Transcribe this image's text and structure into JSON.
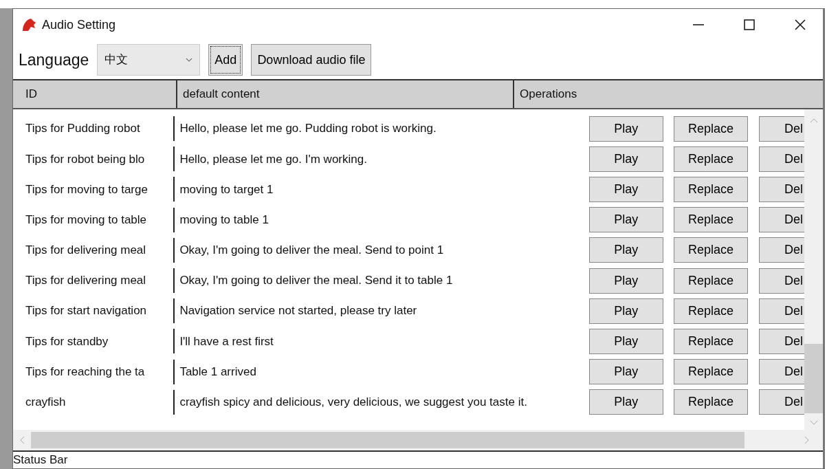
{
  "window": {
    "title": "Audio Setting"
  },
  "toolbar": {
    "language_label": "Language",
    "language_select": {
      "value": "中文"
    },
    "buttons": [
      {
        "label": "Add",
        "focused": true
      },
      {
        "label": "Download audio file",
        "focused": false
      }
    ]
  },
  "table": {
    "columns": [
      "ID",
      "default content",
      "Operations"
    ],
    "rows": [
      {
        "id": "Tips for Pudding robot",
        "content": "Hello, please let me go. Pudding robot is working.",
        "actions": [
          "Play",
          "Replace",
          "Del"
        ]
      },
      {
        "id": "Tips for robot being blo",
        "content": "Hello, please let me go. I'm working.",
        "actions": [
          "Play",
          "Replace",
          "Del"
        ]
      },
      {
        "id": "Tips for moving to targe",
        "content": "moving to target 1",
        "actions": [
          "Play",
          "Replace",
          "Del"
        ]
      },
      {
        "id": "Tips for moving to table",
        "content": "moving to table 1",
        "actions": [
          "Play",
          "Replace",
          "Del"
        ]
      },
      {
        "id": "Tips for delivering meal",
        "content": "Okay, I'm going to deliver the meal. Send to point 1",
        "actions": [
          "Play",
          "Replace",
          "Del"
        ]
      },
      {
        "id": "Tips for delivering meal",
        "content": "Okay, I'm going to deliver the meal. Send it to table 1",
        "actions": [
          "Play",
          "Replace",
          "Del"
        ]
      },
      {
        "id": "Tips for start navigation",
        "content": "Navigation service not started, please try later",
        "actions": [
          "Play",
          "Replace",
          "Del"
        ]
      },
      {
        "id": "Tips for standby",
        "content": "I'll have a rest first",
        "actions": [
          "Play",
          "Replace",
          "Del"
        ]
      },
      {
        "id": "Tips for reaching the ta",
        "content": "Table 1 arrived",
        "actions": [
          "Play",
          "Replace",
          "Del"
        ]
      },
      {
        "id": "crayfish",
        "content": "crayfish spicy and delicious, very delicious, we suggest you taste it.",
        "actions": [
          "Play",
          "Replace",
          "Del"
        ]
      }
    ]
  },
  "status_bar": "Status Bar"
}
